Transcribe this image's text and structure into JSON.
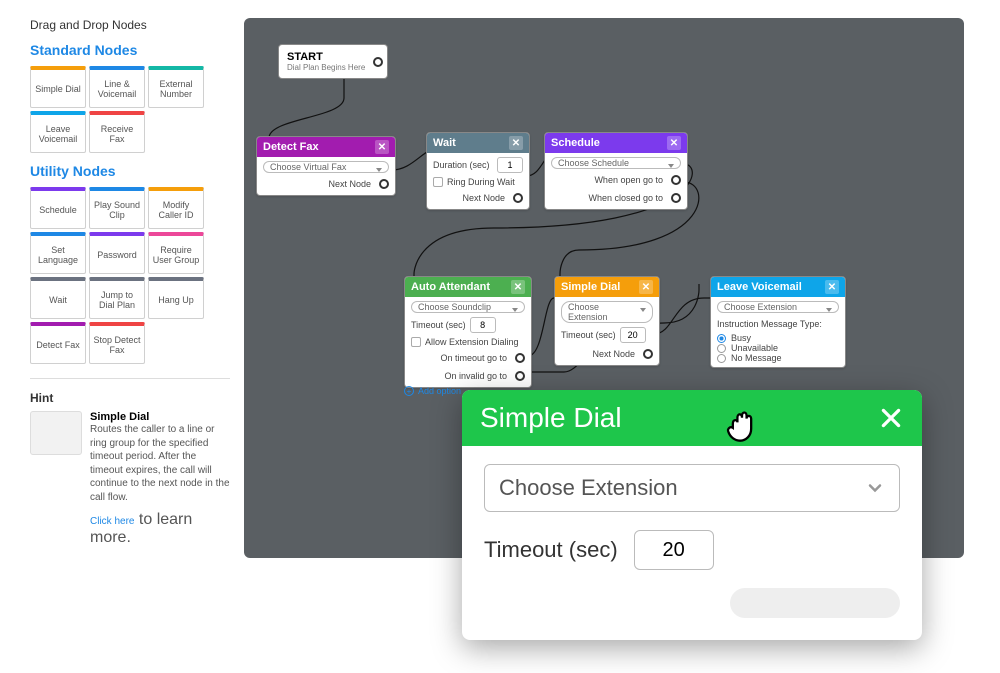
{
  "sidebar": {
    "title": "Drag and Drop Nodes",
    "sections": [
      {
        "title": "Standard Nodes",
        "color": "#1e88e5",
        "items": [
          {
            "label": "Simple Dial",
            "color": "#f59e0b"
          },
          {
            "label": "Line & Voicemail",
            "color": "#1e88e5"
          },
          {
            "label": "External Number",
            "color": "#14b8a6"
          },
          {
            "label": "Leave Voicemail",
            "color": "#0ea5e9"
          },
          {
            "label": "Receive Fax",
            "color": "#ef4444"
          }
        ]
      },
      {
        "title": "Utility Nodes",
        "color": "#1e88e5",
        "items": [
          {
            "label": "Schedule",
            "color": "#7c3aed"
          },
          {
            "label": "Play Sound Clip",
            "color": "#1e88e5"
          },
          {
            "label": "Modify Caller ID",
            "color": "#f59e0b"
          },
          {
            "label": "Set Language",
            "color": "#1e88e5"
          },
          {
            "label": "Password",
            "color": "#7c3aed"
          },
          {
            "label": "Require User Group",
            "color": "#ec4899"
          },
          {
            "label": "Wait",
            "color": "#6b7280"
          },
          {
            "label": "Jump to Dial Plan",
            "color": "#6b7280"
          },
          {
            "label": "Hang Up",
            "color": "#6b7280"
          },
          {
            "label": "Detect Fax",
            "color": "#a21caf"
          },
          {
            "label": "Stop Detect Fax",
            "color": "#ef4444"
          }
        ]
      }
    ],
    "hint": {
      "title": "Hint",
      "heading": "Simple Dial",
      "body": "Routes the caller to a line or ring group for the specified timeout period. After the timeout expires, the call will continue to the next node in the call flow.",
      "link": "Click here",
      "linkRest": " to learn more."
    }
  },
  "canvas": {
    "start": {
      "title": "START",
      "sub": "Dial Plan Begins Here"
    },
    "detectFax": {
      "title": "Detect Fax",
      "select": "Choose Virtual Fax",
      "next": "Next Node"
    },
    "wait": {
      "title": "Wait",
      "durationLabel": "Duration (sec)",
      "duration": "1",
      "ringLabel": "Ring During Wait",
      "next": "Next Node"
    },
    "schedule": {
      "title": "Schedule",
      "select": "Choose Schedule",
      "open": "When open go to",
      "closed": "When closed go to"
    },
    "auto": {
      "title": "Auto Attendant",
      "select": "Choose Soundclip",
      "timeoutLabel": "Timeout (sec)",
      "timeout": "8",
      "allowExt": "Allow Extension Dialing",
      "onTimeout": "On timeout go to",
      "onInvalid": "On invalid go to",
      "addOpt": "Add option"
    },
    "simpleDial": {
      "title": "Simple Dial",
      "select": "Choose Extension",
      "timeoutLabel": "Timeout (sec)",
      "timeout": "20",
      "next": "Next Node"
    },
    "leaveVm": {
      "title": "Leave Voicemail",
      "select": "Choose Extension",
      "instr": "Instruction Message Type:",
      "opts": [
        "Busy",
        "Unavailable",
        "No Message"
      ],
      "checked": 0
    }
  },
  "modal": {
    "title": "Simple Dial",
    "select": "Choose Extension",
    "timeoutLabel": "Timeout (sec)",
    "timeout": "20"
  }
}
